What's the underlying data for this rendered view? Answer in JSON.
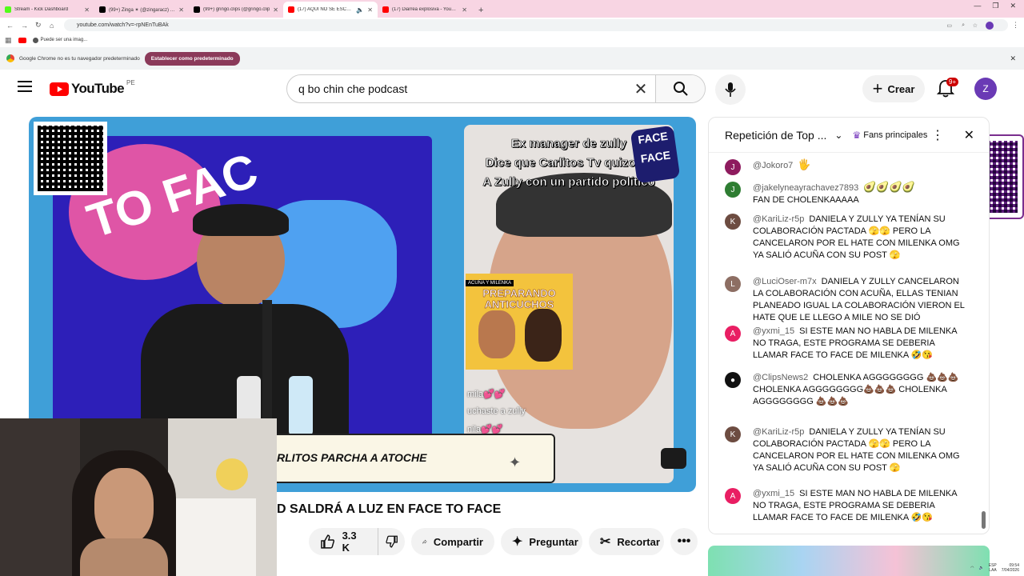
{
  "browser": {
    "tabs": [
      {
        "title": "Stream - Kick Dashboard",
        "color": "#53fc18"
      },
      {
        "title": "(99+) Zinga ✶ (@zingaracz) | Ti",
        "color": "#000000"
      },
      {
        "title": "(99+) gringo.clips (@gringo.clip",
        "color": "#000000"
      },
      {
        "title": "(17) AQUÍ NO SE ESCAPA N",
        "color": "#ff0000"
      },
      {
        "title": "(17) Diarrea explosiva - YouTub",
        "color": "#ff0000"
      }
    ],
    "url": "youtube.com/watch?v=-rpNEnTuBAk",
    "bookmark": "Puede ser una imag...",
    "infobar_text": "Google Chrome no es tu navegador predeterminado",
    "infobar_button": "Establecer como predeterminado"
  },
  "youtube": {
    "logo_text": "YouTube",
    "region": "PE",
    "search_value": "q bo chin che podcast",
    "create_label": "Crear",
    "notif_badge": "9+",
    "avatar_letter": "Z"
  },
  "video": {
    "overlay_headline_1": "Ex manager de zully",
    "overlay_headline_2": "Dice que Carlitos Tv quizo ce",
    "overlay_headline_3": "A Zully con un partido político",
    "lower_third": "RLITOS PARCHA A ATOCHE",
    "inset_title": "PREPARANDO ANTICUCHOS",
    "inset_sub": "ACUÑA Y MILENKA",
    "tiktok_text_1": "mila💕💕",
    "tiktok_text_2": "uchaste a zully",
    "tiktok_text_3": "nila💕💕",
    "title": "D SALDRÁ A LUZ EN FACE TO FACE",
    "likes": "3.3 K",
    "share_label": "Compartir",
    "ask_label": "Preguntar",
    "clip_label": "Recortar"
  },
  "chat": {
    "header_title": "Repetición de Top ...",
    "fans_label": "Fans principales",
    "messages": [
      {
        "initial": "J",
        "color": "#8e1b5e",
        "author": "@Jokoro7",
        "text": "",
        "emoji": "🖐️"
      },
      {
        "initial": "J",
        "color": "#2e7d32",
        "author": "@jakelyneayrachavez7893",
        "text": "FAN DE CHOLENKAAAAA",
        "emoji": "🥑🥑🥑🥑"
      },
      {
        "initial": "K",
        "color": "#6d4c41",
        "author": "@KariLiz-r5p",
        "text": "DANIELA Y ZULLY YA TENÍAN SU COLABORACIÓN PACTADA 🫣🫣 PERO LA CANCELARON POR EL HATE CON MILENKA OMG YA SALIÓ ACUÑA CON SU POST 🫣",
        "emoji": ""
      },
      {
        "initial": "L",
        "color": "#8d6e63",
        "author": "@LuciOser-m7x",
        "text": "DANIELA Y ZULLY CANCELARON LA COLABORACIÓN CON ACUÑA, ELLAS TENIAN PLANEADO IGUAL LA COLABORACIÓN VIERON EL HATE QUE LE LLEGO A MILE NO SE DIÓ",
        "emoji": ""
      },
      {
        "initial": "A",
        "color": "#e91e63",
        "author": "@yxmi_15",
        "text": "SI ESTE MAN NO HABLA DE MILENKA NO TRAGA, ESTE PROGRAMA SE DEBERIA LLAMAR FACE TO FACE DE MILENKA 🤣😘",
        "emoji": ""
      },
      {
        "initial": "●",
        "color": "#111111",
        "author": "@ClipsNews2",
        "text": "CHOLENKA AGGGGGGGG 💩💩💩CHOLENKA AGGGGGGGG💩💩💩 CHOLENKA AGGGGGGGG 💩💩💩",
        "emoji": ""
      },
      {
        "initial": "K",
        "color": "#6d4c41",
        "author": "@KariLiz-r5p",
        "text": "DANIELA Y ZULLY YA TENÍAN SU COLABORACIÓN PACTADA 🫣🫣 PERO LA CANCELARON POR EL HATE CON MILENKA OMG YA SALIÓ ACUÑA CON SU POST 🫣",
        "emoji": ""
      },
      {
        "initial": "A",
        "color": "#e91e63",
        "author": "@yxmi_15",
        "text": "SI ESTE MAN NO HABLA DE MILENKA NO TRAGA, ESTE PROGRAMA SE DEBERIA LLAMAR FACE TO FACE DE MILENKA 🤣😘",
        "emoji": ""
      }
    ]
  },
  "taskbar": {
    "lang": "ESP",
    "lang2": "LAA",
    "time": "09:54",
    "date": "7/04/2026"
  }
}
